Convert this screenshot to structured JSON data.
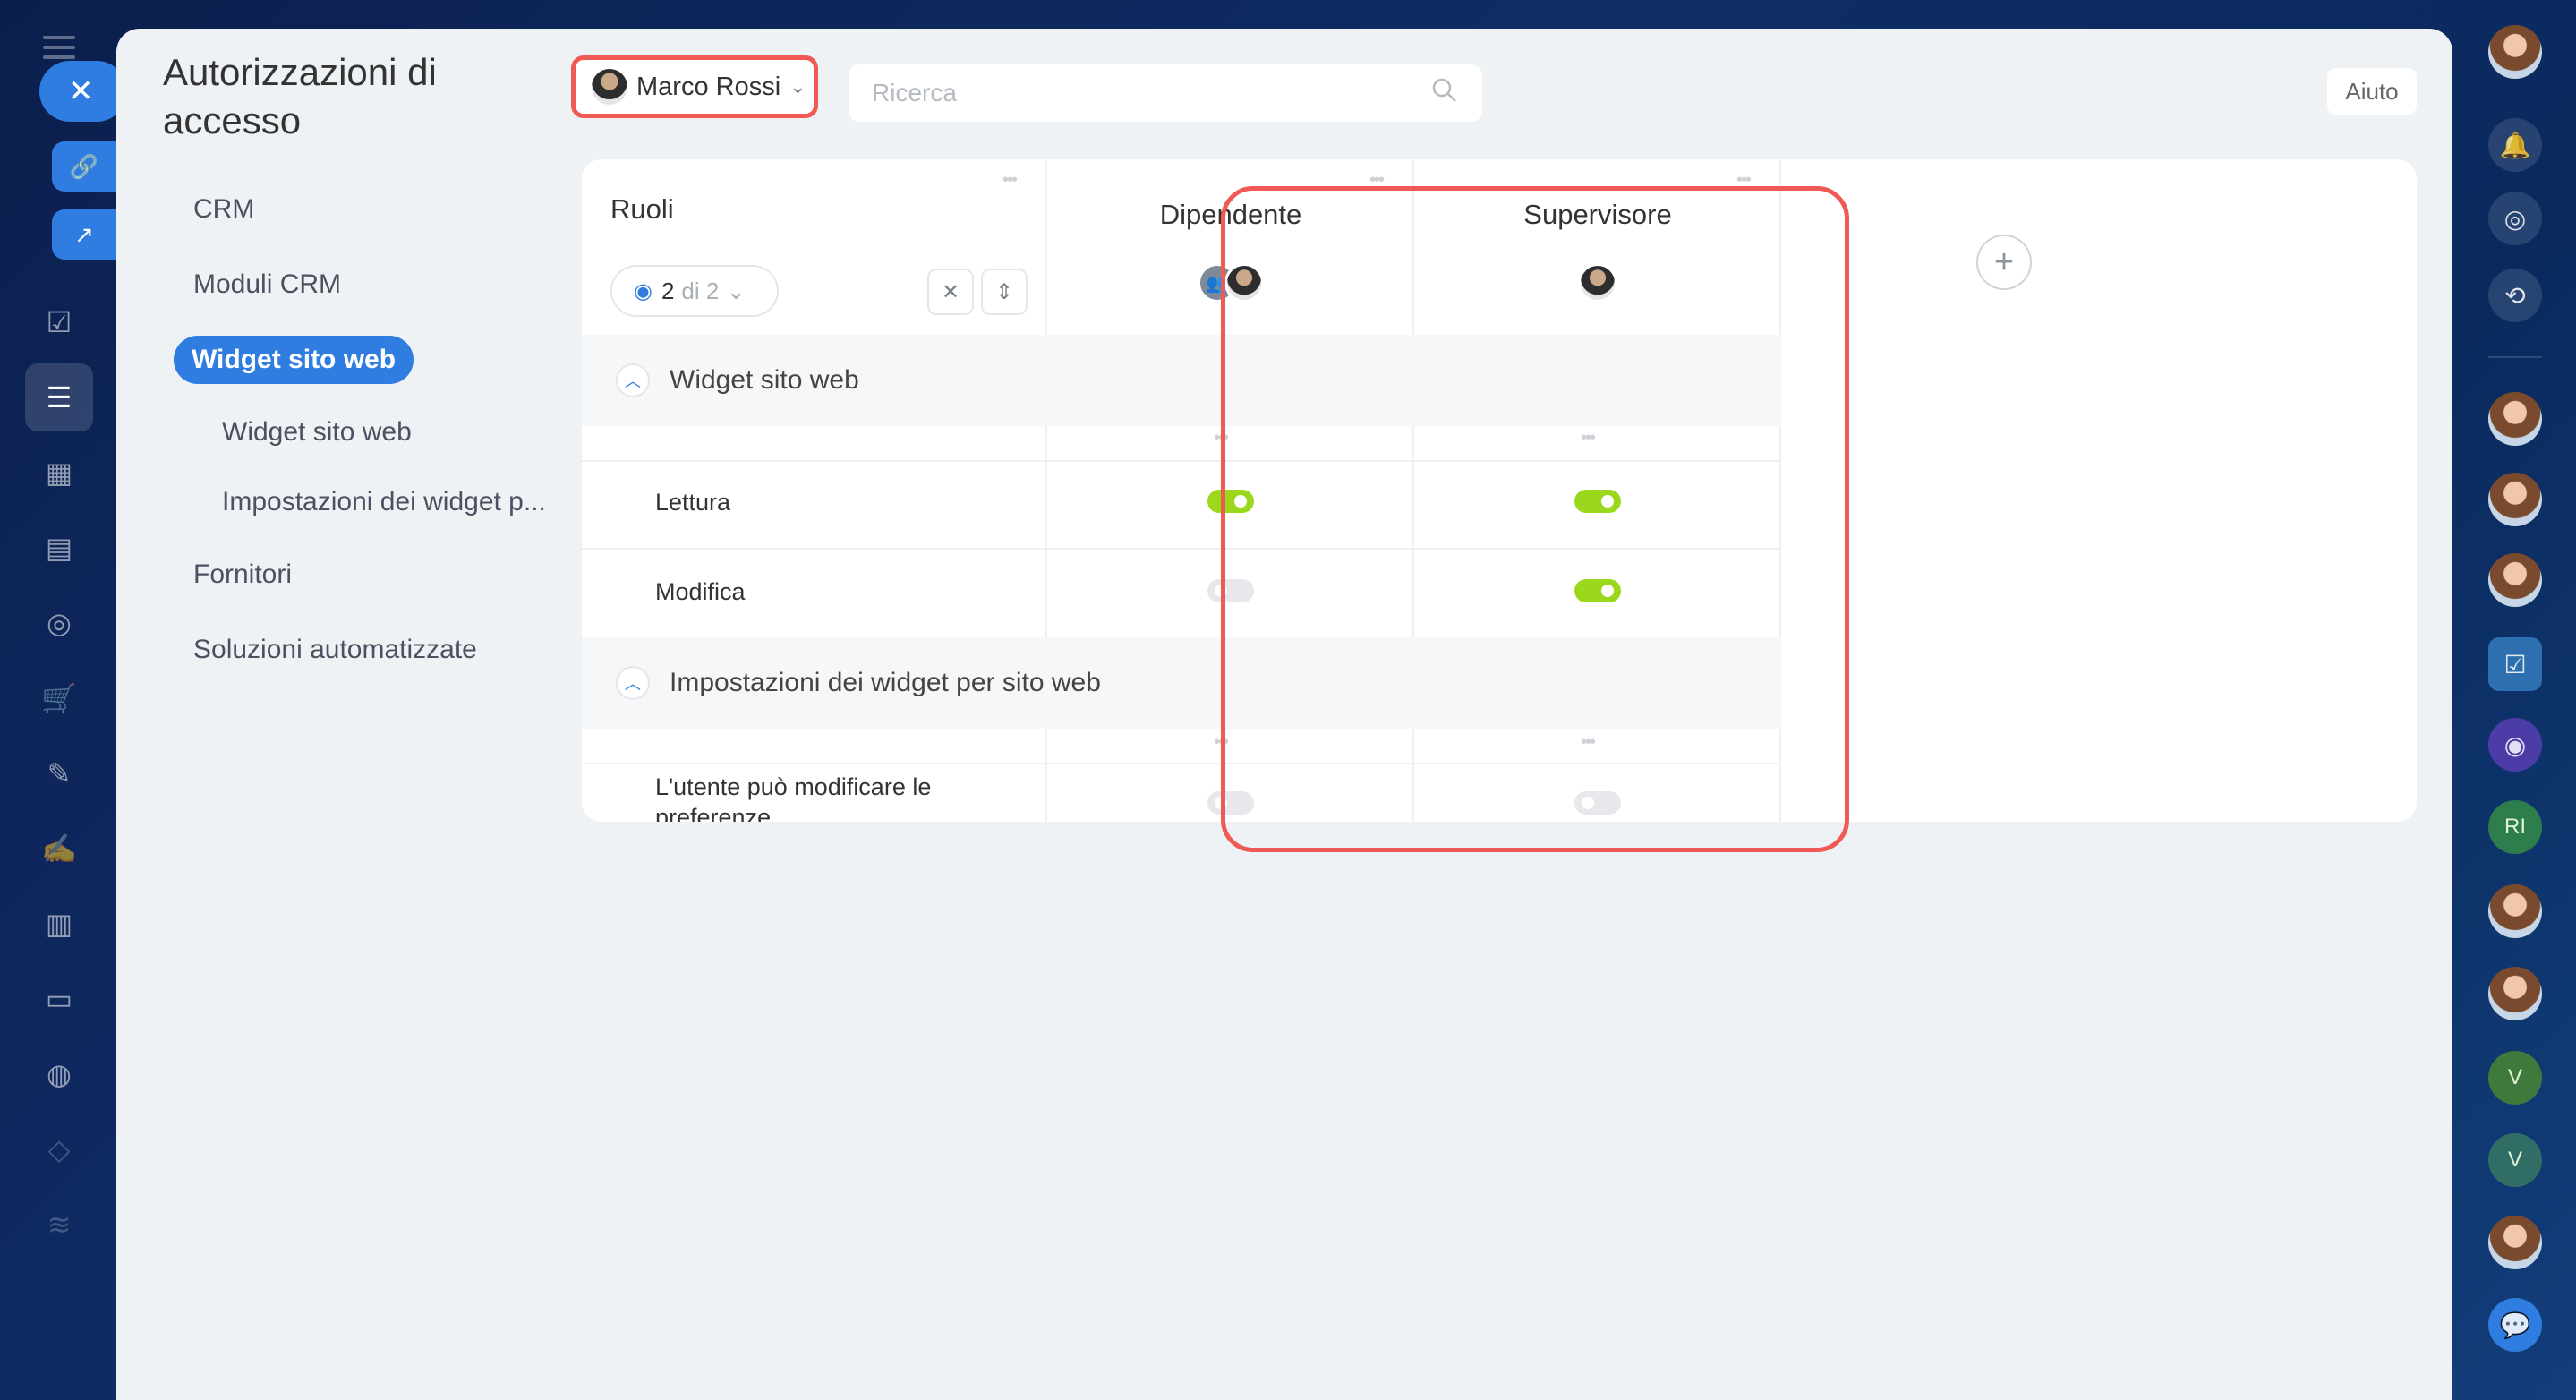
{
  "page": {
    "title": "Autorizzazioni di accesso",
    "help_label": "Aiuto"
  },
  "sidebar": {
    "items": [
      {
        "label": "CRM"
      },
      {
        "label": "Moduli CRM"
      },
      {
        "label": "Widget sito web"
      },
      {
        "label": "Widget sito web"
      },
      {
        "label": "Impostazioni dei widget p..."
      },
      {
        "label": "Fornitori"
      },
      {
        "label": "Soluzioni automatizzate"
      }
    ]
  },
  "toolbar": {
    "user_name": "Marco Rossi",
    "search_placeholder": "Ricerca"
  },
  "table": {
    "roles_header": "Ruoli",
    "view_count": "2",
    "view_of": "di 2",
    "roles": [
      {
        "name": "Dipendente"
      },
      {
        "name": "Supervisore"
      }
    ],
    "sections": [
      {
        "title": "Widget sito web",
        "permissions": [
          {
            "label": "Lettura",
            "values": [
              true,
              true
            ]
          },
          {
            "label": "Modifica",
            "values": [
              false,
              true
            ]
          }
        ]
      },
      {
        "title": "Impostazioni dei widget per sito web",
        "permissions": [
          {
            "label": "L'utente può modificare le preferenze",
            "values": [
              false,
              false
            ]
          }
        ]
      }
    ]
  },
  "right_rail": {
    "letters": [
      "RI",
      "V",
      "V"
    ]
  },
  "colors": {
    "accent": "#2f7de1",
    "toggle_on": "#9bd81c",
    "highlight": "#ef5a55"
  }
}
